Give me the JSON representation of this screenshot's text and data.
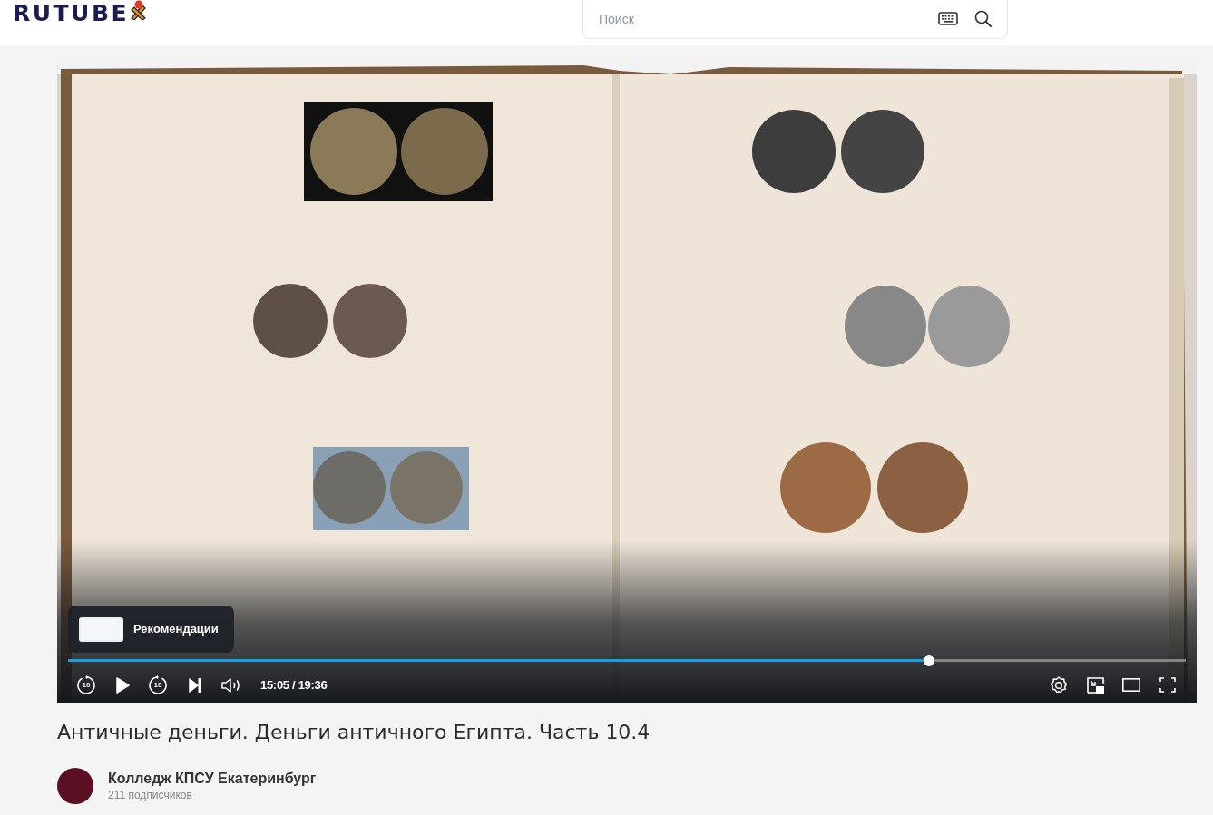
{
  "header": {
    "logo": "RUTUBE",
    "search": {
      "placeholder": "Поиск"
    }
  },
  "player": {
    "paused": true,
    "rewind_label": "10",
    "forward_label": "10",
    "recommendations": {
      "label": "Рекомендации"
    },
    "progress": {
      "level": 0.77
    },
    "time": "15:05 / 19:36"
  },
  "video": {
    "title": "Античные деньги. Деньги античного Египта. Часть 10.4",
    "channel": {
      "name": "Колледж КПСУ Екатеринбург",
      "subscribers": "211 подписчиков"
    }
  }
}
